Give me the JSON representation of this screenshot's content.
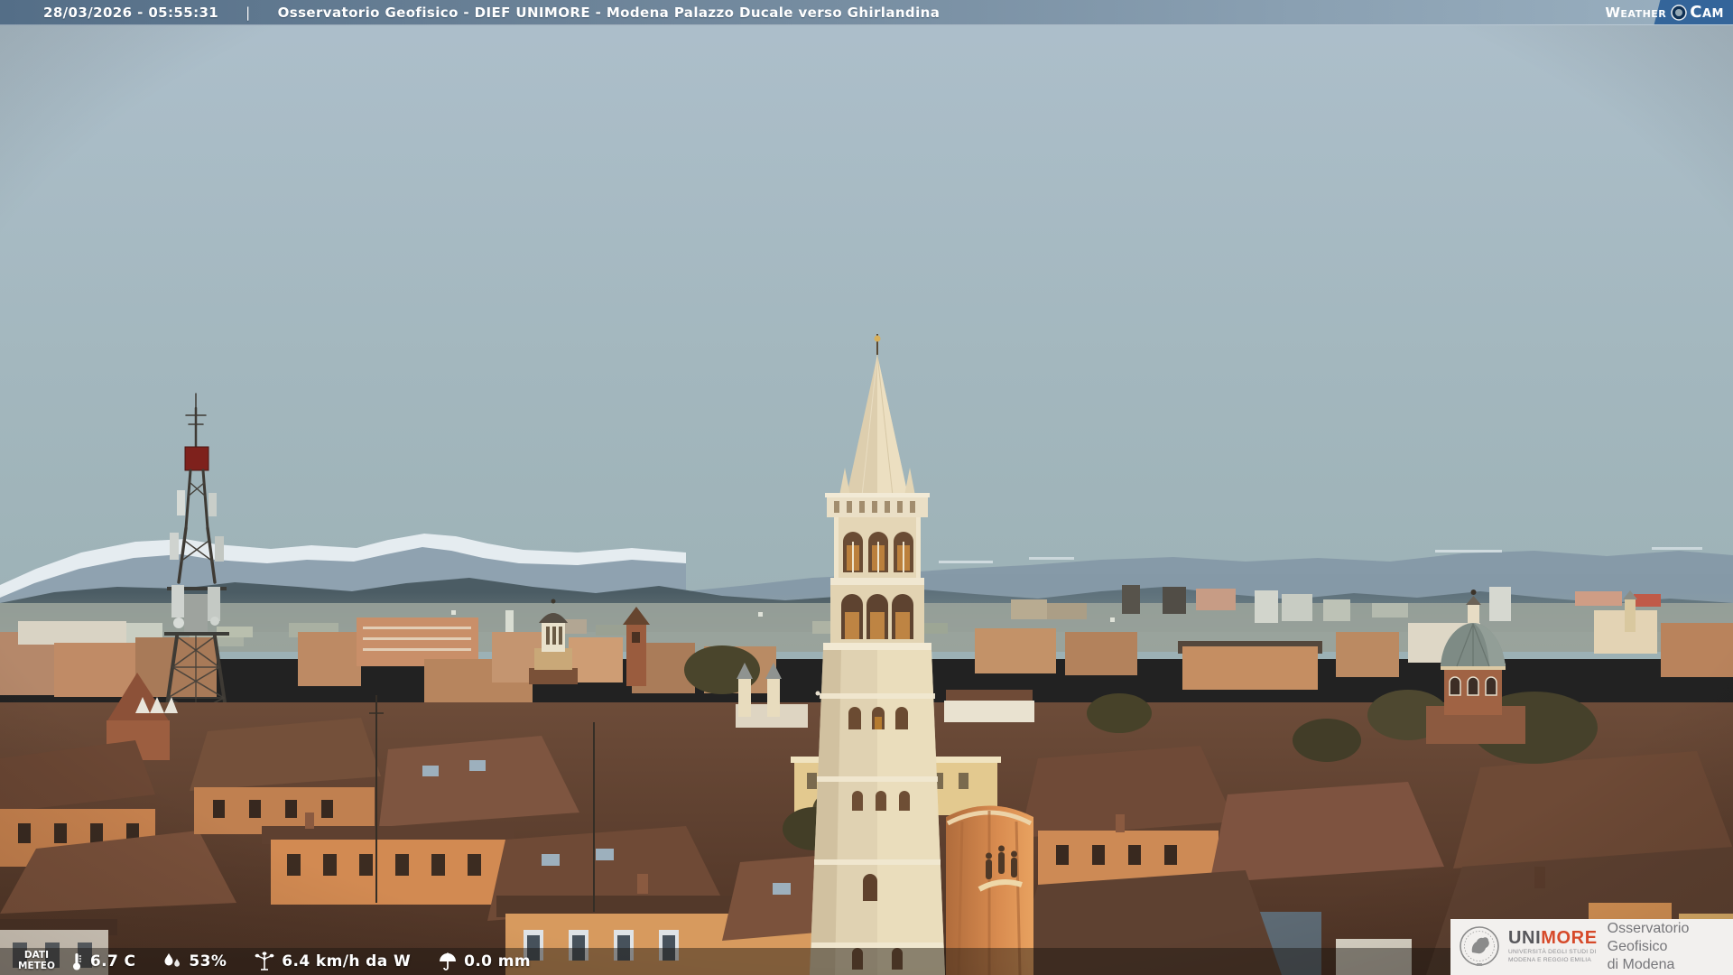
{
  "header": {
    "timestamp": "28/03/2026 - 05:55:31",
    "separator": "|",
    "title": "Osservatorio Geofisico - DIEF UNIMORE - Modena Palazzo Ducale verso Ghirlandina",
    "logo": {
      "weather": "Weather",
      "cam": "Cam"
    },
    "colors": {
      "bar_left": "#546e87",
      "bar_right": "#9ab0c0",
      "logo_blue": "#34659a"
    }
  },
  "weather_bar": {
    "label_line1": "DATI",
    "label_line2": "METEO",
    "readings": [
      {
        "icon": "thermometer-icon",
        "value": "6.7 C"
      },
      {
        "icon": "humidity-icon",
        "value": "53%"
      },
      {
        "icon": "anemometer-icon",
        "value": "6.4 km/h da W"
      },
      {
        "icon": "umbrella-icon",
        "value": "0.0 mm"
      }
    ]
  },
  "branding": {
    "unimore_uni": "UNI",
    "unimore_more": "MORE",
    "subtitle_line1": "UNIVERSITÀ DEGLI STUDI DI",
    "subtitle_line2": "MODENA E REGGIO EMILIA",
    "org_line1": "Osservatorio Geofisico",
    "org_line2": "di Modena",
    "more_color": "#d64a2a",
    "background": "#f2f0ee"
  },
  "scene": {
    "description": "Dawn webcam view over the rooftops of Modena toward the Ghirlandina tower, telecom lattice tower at left, church dome at right, snow-capped Apennines on the horizon",
    "sky_top_color": "#adbfcb",
    "sky_horizon_color": "#9cb1b5"
  }
}
